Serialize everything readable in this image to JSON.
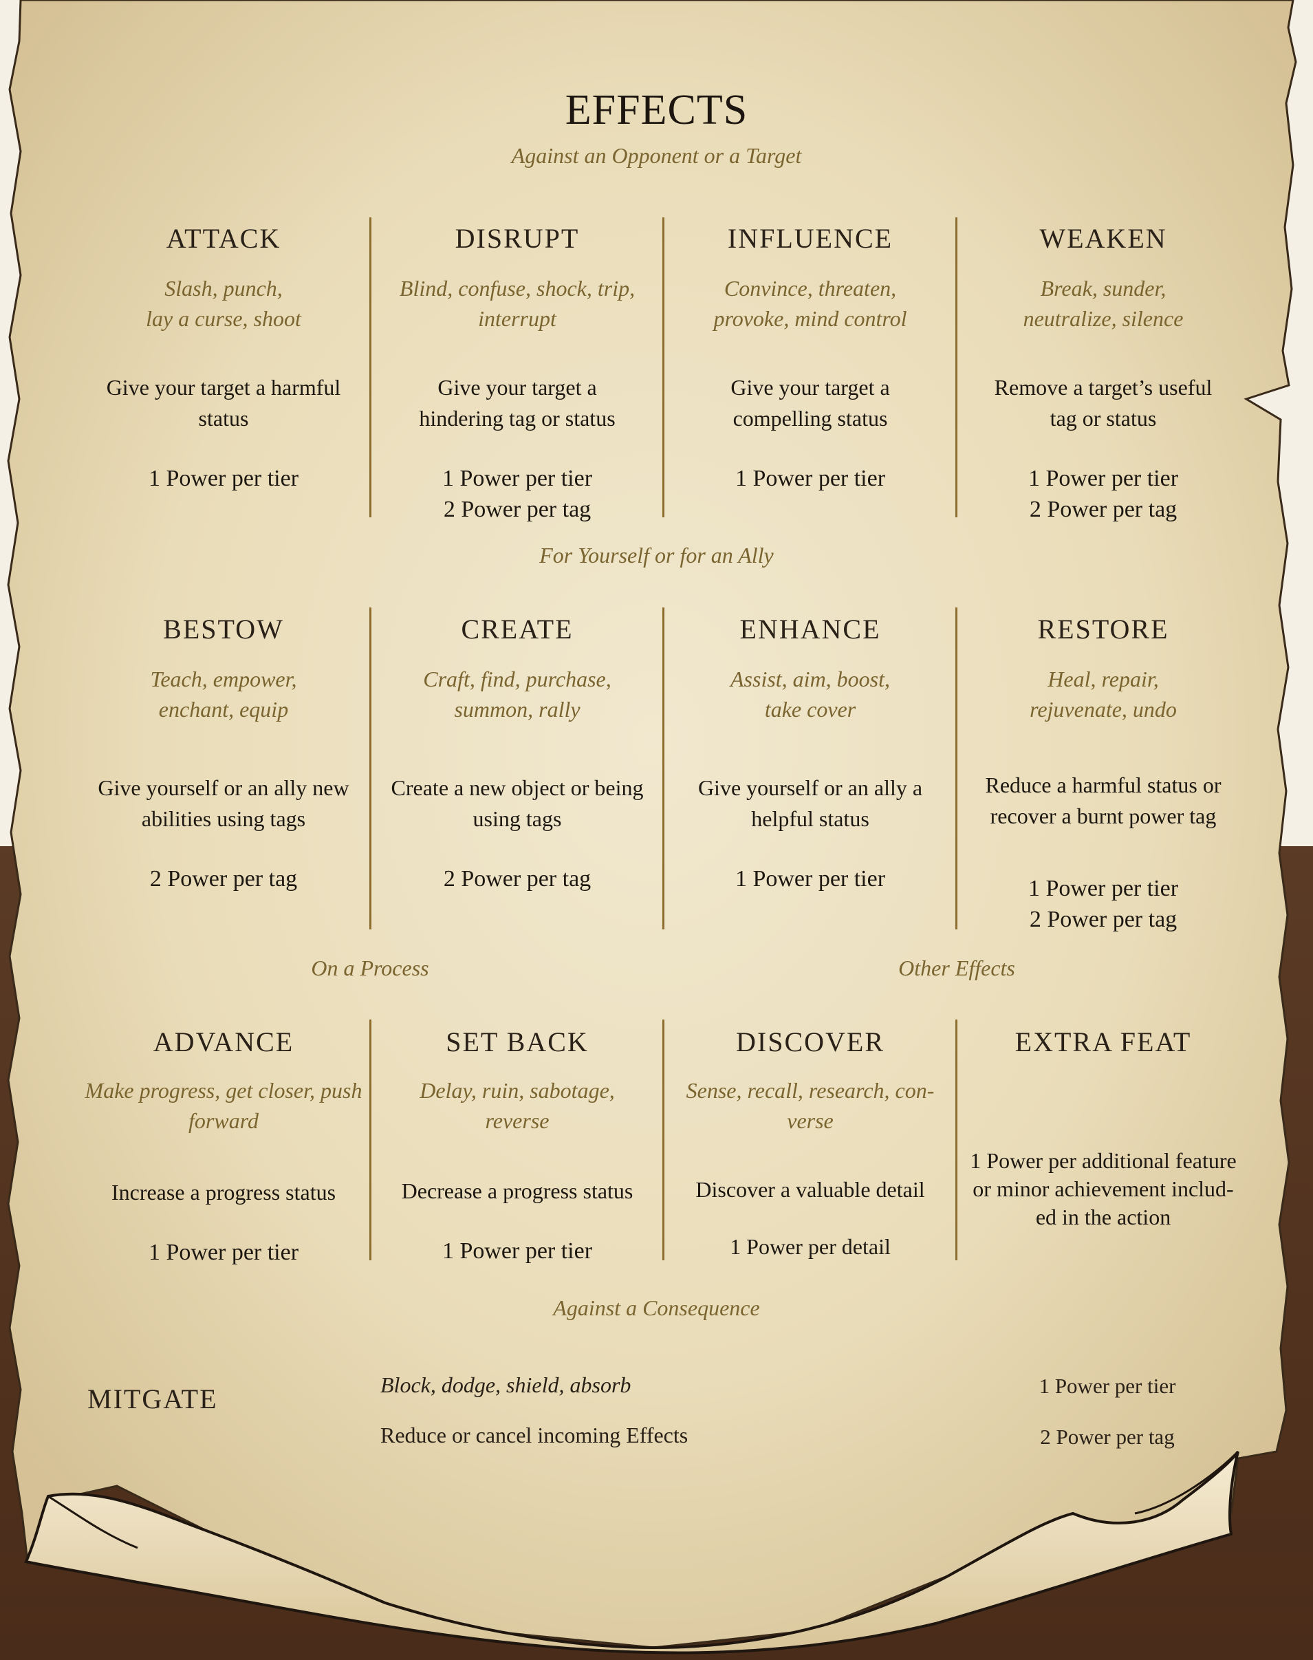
{
  "title": "EFFECTS",
  "sections": [
    {
      "label": "Against an Opponent or a Target",
      "columns": [
        {
          "heading": "ATTACK",
          "examples": [
            "Slash, punch,",
            "lay a curse, shoot"
          ],
          "description": [
            "Give your target a harmful",
            "status"
          ],
          "costs": [
            "1 Power per tier"
          ]
        },
        {
          "heading": "DISRUPT",
          "examples": [
            "Blind, confuse, shock, trip,",
            "interrupt"
          ],
          "description": [
            "Give your target a",
            "hindering tag or status"
          ],
          "costs": [
            "1 Power per tier",
            "2 Power per tag"
          ]
        },
        {
          "heading": "INFLUENCE",
          "examples": [
            "Convince, threaten,",
            "provoke, mind control"
          ],
          "description": [
            "Give your target a",
            "compelling status"
          ],
          "costs": [
            "1 Power per tier"
          ]
        },
        {
          "heading": "WEAKEN",
          "examples": [
            "Break, sunder,",
            "neutralize, silence"
          ],
          "description": [
            "Remove a target’s useful",
            "tag or status"
          ],
          "costs": [
            "1 Power per tier",
            "2 Power per tag"
          ]
        }
      ]
    },
    {
      "label": "For Yourself or for an Ally",
      "columns": [
        {
          "heading": "BESTOW",
          "examples": [
            "Teach, empower,",
            "enchant, equip"
          ],
          "description": [
            "Give yourself or an ally new",
            "abilities using tags"
          ],
          "costs": [
            "2 Power per tag"
          ]
        },
        {
          "heading": "CREATE",
          "examples": [
            "Craft, find, purchase,",
            "summon, rally"
          ],
          "description": [
            "Create a new object or being",
            "using tags"
          ],
          "costs": [
            "2 Power per tag"
          ]
        },
        {
          "heading": "ENHANCE",
          "examples": [
            "Assist, aim, boost,",
            "take cover"
          ],
          "description": [
            "Give yourself or an ally a",
            "helpful status"
          ],
          "costs": [
            "1 Power per tier"
          ]
        },
        {
          "heading": "RESTORE",
          "examples": [
            "Heal, repair,",
            "rejuvenate, undo"
          ],
          "description": [
            "Reduce a harmful status or",
            "recover a burnt power tag"
          ],
          "costs": [
            "1 Power per tier",
            "2 Power per tag"
          ]
        }
      ]
    },
    {
      "labels": [
        "On a Process",
        "Other Effects"
      ],
      "columns": [
        {
          "heading": "ADVANCE",
          "examples": [
            "Make progress, get closer, push",
            "forward"
          ],
          "description": [
            "Increase a progress status"
          ],
          "costs": [
            "1 Power per tier"
          ]
        },
        {
          "heading": "SET BACK",
          "examples": [
            "Delay, ruin, sabotage,",
            "reverse"
          ],
          "description": [
            "Decrease a progress status"
          ],
          "costs": [
            "1 Power per tier"
          ]
        },
        {
          "heading": "DISCOVER",
          "examples": [
            "Sense, recall, research, con-",
            "verse"
          ],
          "description": [
            "Discover a valuable detail"
          ],
          "costs": [
            "1 Power per detail"
          ]
        },
        {
          "heading": "EXTRA FEAT",
          "examples": [],
          "description": [
            "1 Power per additional feature",
            "or minor achievement includ-",
            "ed in the action"
          ],
          "costs": []
        }
      ]
    }
  ],
  "consequence": {
    "label": "Against a Consequence",
    "heading": "MITGATE",
    "examples": "Block, dodge, shield, absorb",
    "description": "Reduce or cancel incoming Effects",
    "costs": [
      "1 Power per tier",
      "2 Power per tag"
    ]
  },
  "colors": {
    "accent": "#7a6530",
    "text": "#1e1812",
    "divider": "#8c6d2e",
    "parchment": "#ede2c4",
    "backdrop": "#5e3a22"
  }
}
